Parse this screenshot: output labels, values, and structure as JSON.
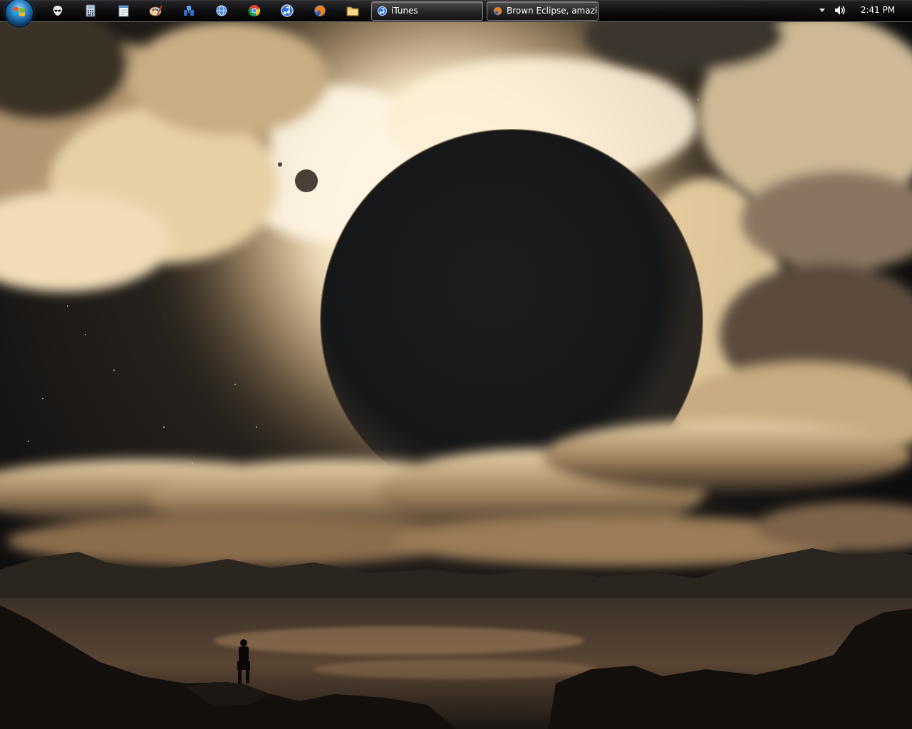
{
  "wallpaper": {
    "subject": "dark planet eclipsing a glowing sun above clouds, lone figure on rocks by a lake"
  },
  "taskbar": {
    "start_button": {
      "icon": "windows-start-orb-icon"
    },
    "quick_launch": [
      {
        "icon": "alien-app-icon"
      },
      {
        "icon": "calculator-icon"
      },
      {
        "icon": "notepad-icon"
      },
      {
        "icon": "paint-icon"
      },
      {
        "icon": "network-icon"
      },
      {
        "icon": "globe-icon"
      },
      {
        "icon": "chrome-icon"
      },
      {
        "icon": "itunes-icon"
      },
      {
        "icon": "firefox-icon"
      },
      {
        "icon": "folder-icon"
      }
    ],
    "windows": [
      {
        "label": "iTunes",
        "icon": "itunes-icon"
      },
      {
        "label": "Brown Eclipse, amazi...",
        "icon": "firefox-icon"
      }
    ],
    "tray": {
      "chevron_icon": "show-hidden-icons-chevron",
      "volume_icon": "speaker-volume-icon",
      "clock": "2:41 PM"
    }
  },
  "colors": {
    "taskbar": "#0e0e10",
    "accent_glow": "#f6e2b4",
    "text": "#ffffff"
  }
}
